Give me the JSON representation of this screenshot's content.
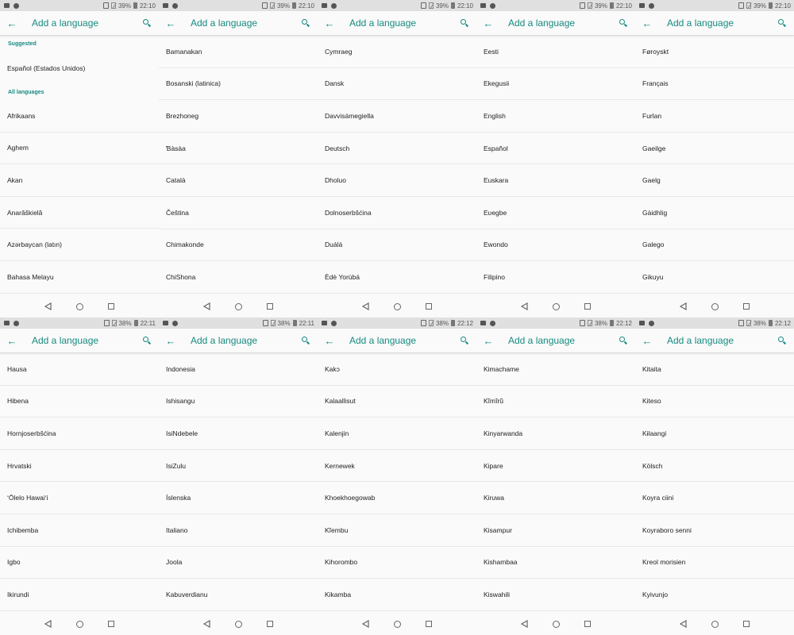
{
  "screens": [
    {
      "status": {
        "battery": "39%",
        "time": "22:10"
      },
      "title": "Add a language",
      "suggested_header": "Suggested",
      "suggested": [
        "Español (Estados Unidos)"
      ],
      "all_header": "All languages",
      "items": [
        "Afrikaans",
        "Aghem",
        "Akan",
        "Anarâškielâ",
        "Azərbaycan (latın)",
        "Bahasa Melayu"
      ]
    },
    {
      "status": {
        "battery": "39%",
        "time": "22:10"
      },
      "title": "Add a language",
      "items": [
        "Bamanakan",
        "Bosanski (latinica)",
        "Brezhoneg",
        "Ɓàsàa",
        "Català",
        "Čeština",
        "Chimakonde",
        "ChiShona"
      ]
    },
    {
      "status": {
        "battery": "39%",
        "time": "22:10"
      },
      "title": "Add a language",
      "items": [
        "Cymraeg",
        "Dansk",
        "Davvisámegiella",
        "Deutsch",
        "Dholuo",
        "Dolnoserbšćina",
        "Duálá",
        "Èdè Yorùbá"
      ]
    },
    {
      "status": {
        "battery": "39%",
        "time": "22:10"
      },
      "title": "Add a language",
      "items": [
        "Eesti",
        "Ekegusii",
        "English",
        "Español",
        "Euskara",
        "Eʋegbe",
        "Ewondo",
        "Filipino"
      ]
    },
    {
      "status": {
        "battery": "39%",
        "time": "22:10"
      },
      "title": "Add a language",
      "items": [
        "Føroyskt",
        "Français",
        "Furlan",
        "Gaeilge",
        "Gaelg",
        "Gàidhlig",
        "Galego",
        "Gikuyu"
      ]
    },
    {
      "status": {
        "battery": "38%",
        "time": "22:11"
      },
      "title": "Add a language",
      "items": [
        "Hausa",
        "Hibena",
        "Hornjoserbšćina",
        "Hrvatski",
        "ʻŌlelo Hawaiʻi",
        "Ichibemba",
        "Igbo",
        "Ikirundi"
      ]
    },
    {
      "status": {
        "battery": "38%",
        "time": "22:11"
      },
      "title": "Add a language",
      "items": [
        "Indonesia",
        "Ishisangu",
        "IsiNdebele",
        "IsiZulu",
        "Íslenska",
        "Italiano",
        "Joola",
        "Kabuverdianu"
      ]
    },
    {
      "status": {
        "battery": "38%",
        "time": "22:12"
      },
      "title": "Add a language",
      "items": [
        "Kakɔ",
        "Kalaallisut",
        "Kalenjin",
        "Kernewek",
        "Khoekhoegowab",
        "Kĩembu",
        "Kihorombo",
        "Kikamba"
      ]
    },
    {
      "status": {
        "battery": "38%",
        "time": "22:12"
      },
      "title": "Add a language",
      "items": [
        "Kimachame",
        "Kĩmĩrũ",
        "Kinyarwanda",
        "Kipare",
        "Kiruwa",
        "Kisampur",
        "Kishambaa",
        "Kiswahili"
      ]
    },
    {
      "status": {
        "battery": "38%",
        "time": "22:12"
      },
      "title": "Add a language",
      "items": [
        "Kitaita",
        "Kiteso",
        "Kɨlaangi",
        "Kölsch",
        "Koyra ciini",
        "Koyraboro senni",
        "Kreol morisien",
        "Kyivunjo"
      ]
    }
  ],
  "icons": {
    "back": "arrow-back-icon",
    "search": "search-icon",
    "nav": [
      "nav-back-icon",
      "nav-home-icon",
      "nav-recents-icon"
    ]
  },
  "colors": {
    "accent": "#168a80",
    "statusbar": "#e0e0e0",
    "background": "#fafafa"
  }
}
